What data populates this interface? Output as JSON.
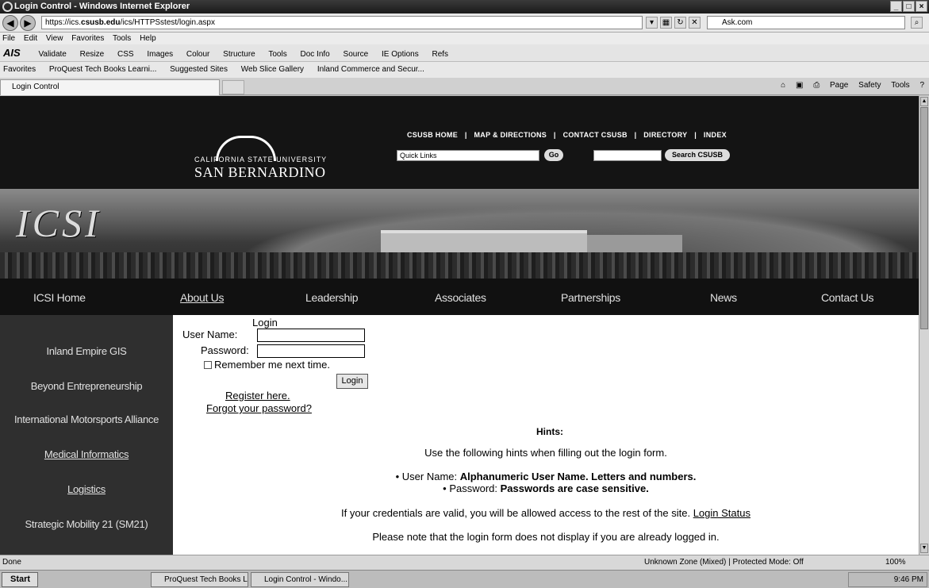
{
  "window": {
    "title": "Login Control - Windows Internet Explorer"
  },
  "address": {
    "url_prefix": "https://ics.",
    "url_domain": "csusb.edu",
    "url_rest": "/ics/HTTPSstest/login.aspx",
    "search_text": "Ask.com"
  },
  "menu": [
    "File",
    "Edit",
    "View",
    "Favorites",
    "Tools",
    "Help"
  ],
  "ais_toolbar": [
    "Validate",
    "Resize",
    "CSS",
    "Images",
    "Colour",
    "Structure",
    "Tools",
    "Doc Info",
    "Source",
    "IE Options",
    "Refs"
  ],
  "favorites": [
    "Favorites",
    "ProQuest Tech Books Learni...",
    "Suggested Sites",
    "Web Slice Gallery",
    "Inland Commerce and Secur..."
  ],
  "tab": {
    "label": "Login Control"
  },
  "command_bar": [
    "Page",
    "Safety",
    "Tools"
  ],
  "header": {
    "logo_line1": "CALIFORNIA STATE UNIVERSITY",
    "logo_line2": "SAN BERNARDINO",
    "top_links": [
      "CSUSB HOME",
      "|",
      "MAP & DIRECTIONS",
      "|",
      "CONTACT CSUSB",
      "|",
      "DIRECTORY",
      "|",
      "INDEX"
    ],
    "quick_links": "Quick Links",
    "go": "Go",
    "search_button": "Search CSUSB"
  },
  "banner": {
    "text": "ICSI"
  },
  "nav": [
    "ICSI Home",
    "About Us",
    "Leadership",
    "Associates",
    "Partnerships",
    "News",
    "Contact Us"
  ],
  "sidebar": [
    "Inland Empire GIS",
    "Beyond Entrepreneurship",
    "International Motorsports Alliance",
    "Medical Informatics",
    "Logistics",
    "Strategic Mobility 21 (SM21)"
  ],
  "login": {
    "title": "Login",
    "username_label": "User Name:",
    "password_label": "Password:",
    "remember": "Remember me next time.",
    "button": "Login",
    "register": "Register here.",
    "forgot": "Forgot your password?"
  },
  "hints": {
    "title": "Hints:",
    "intro": "Use the following hints when filling out the login form.",
    "user_prefix": "User Name: ",
    "user_bold": "Alphanumeric User Name. Letters and numbers.",
    "pass_prefix": "Password: ",
    "pass_bold": "Passwords are case sensitive.",
    "valid_text": "If your credentials are valid, you will be allowed access to the rest of the site. ",
    "login_status": "Login Status",
    "note": "Please note that the login form does not display if you are already logged in."
  },
  "status": {
    "left": "Done",
    "zone": "Unknown Zone (Mixed) | Protected Mode: Off",
    "zoom": "100%"
  },
  "taskbar": {
    "start": "Start",
    "tasks": [
      "ProQuest Tech Books Le...",
      "Login Control - Windo..."
    ],
    "time": "9:46 PM"
  }
}
